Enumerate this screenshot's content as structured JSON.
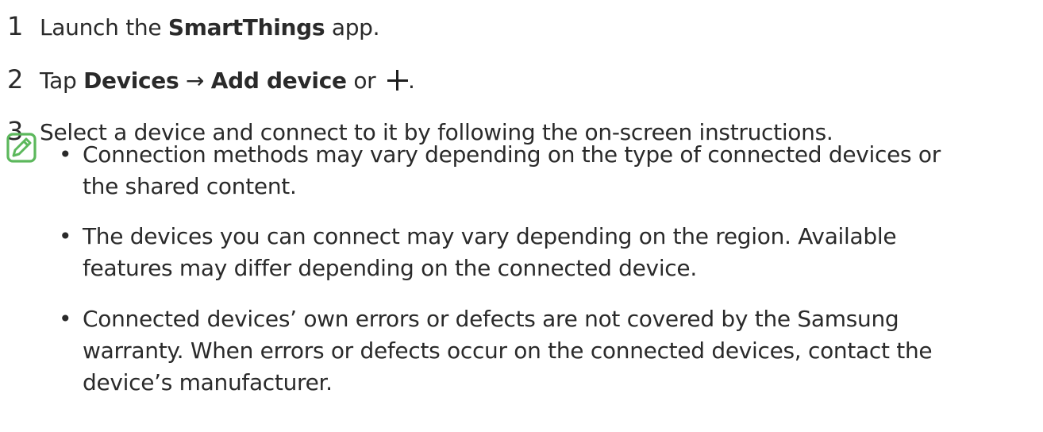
{
  "steps": [
    {
      "number": "1",
      "pre": "Launch the ",
      "bold": "SmartThings",
      "post": " app."
    },
    {
      "number": "2",
      "pre": "Tap ",
      "bold1": "Devices",
      "arrow": " → ",
      "bold2": "Add device",
      "post": " or ",
      "end": ".",
      "icon": "plus-icon"
    },
    {
      "number": "3",
      "text": "Select a device and connect to it by following the on-screen instructions."
    }
  ],
  "note": {
    "icon": "note-pencil-icon",
    "bullet_symbol": "•",
    "items": [
      {
        "lines": [
          "Connection methods may vary depending on the type of connected devices or",
          "the shared content."
        ]
      },
      {
        "lines": [
          "The devices you can connect may vary depending on the region. Available",
          "features may differ depending on the connected device."
        ]
      },
      {
        "lines": [
          "Connected devices’ own errors or defects are not covered by the Samsung",
          "warranty. When errors or defects occur on the connected devices, contact the",
          "device’s manufacturer."
        ]
      }
    ]
  },
  "colors": {
    "note_icon_green": "#5cb85c",
    "text": "#2a2a2a"
  }
}
